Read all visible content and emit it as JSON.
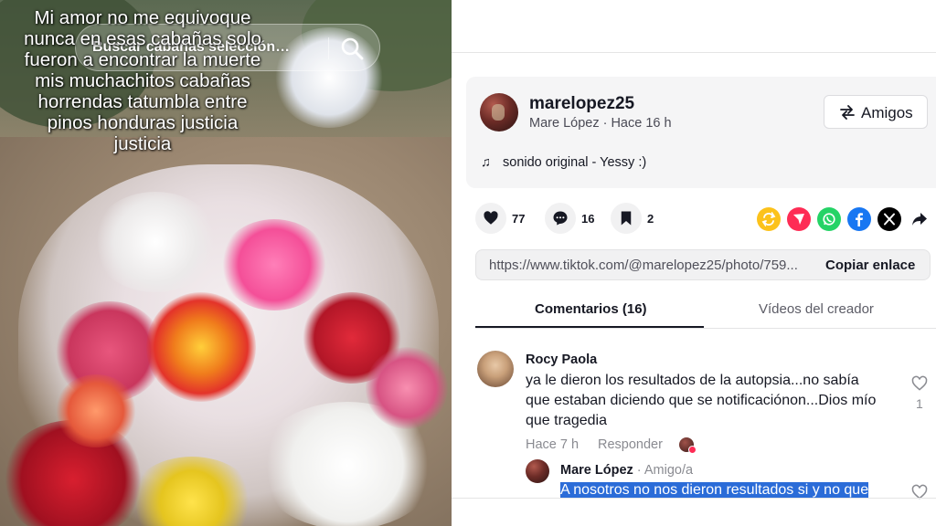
{
  "photo": {
    "caption": "Mi amor no me equivoque\nnunca en esas cabañas solo\nfueron a encontrar la muerte\nmis muchachitos cabañas\nhorrendas tatumbla entre\npinos honduras justicia\njusticia",
    "search_placeholder": "Buscar cabañas selección…"
  },
  "author": {
    "username": "marelopez25",
    "display_line": "Mare López · Hace 16 h",
    "friends_label": "Amigos"
  },
  "sound": {
    "label": "sonido original - Yessy :)"
  },
  "actions": {
    "likes": "77",
    "comments": "16",
    "saves": "2"
  },
  "share_icons": [
    "repost-icon",
    "send-icon",
    "whatsapp-icon",
    "facebook-icon",
    "x-icon",
    "share-arrow-icon"
  ],
  "share_colors": {
    "repost": "#fcc21b",
    "send": "#fe2c55",
    "whatsapp": "#25d366",
    "facebook": "#1877f2",
    "x": "#000000"
  },
  "link": {
    "url": "https://www.tiktok.com/@marelopez25/photo/759...",
    "copy_label": "Copiar enlace"
  },
  "tabs": {
    "comments": "Comentarios (16)",
    "videos": "Vídeos del creador"
  },
  "comments": [
    {
      "name": "Rocy Paola",
      "text": "ya le dieron los resultados de la autopsia...no sabía que estaban diciendo que se notificaciónon...Dios mío que tragedia",
      "time": "Hace 7 h",
      "reply_label": "Responder",
      "likes": "1"
    },
    {
      "name": "Mare López",
      "badge": "· Amigo/a",
      "text": "A nosotros no nos dieron resultados si y no que"
    }
  ]
}
